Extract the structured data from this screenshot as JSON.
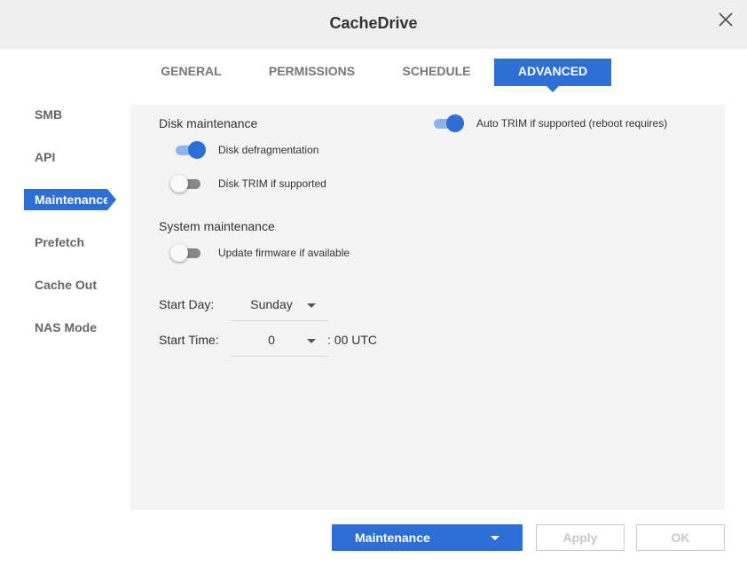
{
  "window": {
    "title": "CacheDrive"
  },
  "tabs": [
    {
      "label": "GENERAL"
    },
    {
      "label": "PERMISSIONS"
    },
    {
      "label": "SCHEDULE"
    },
    {
      "label": "ADVANCED",
      "active": true
    }
  ],
  "sidebar": {
    "items": [
      {
        "label": "SMB"
      },
      {
        "label": "API"
      },
      {
        "label": "Maintenance",
        "active": true
      },
      {
        "label": "Prefetch"
      },
      {
        "label": "Cache Out"
      },
      {
        "label": "NAS Mode"
      }
    ]
  },
  "disk_maintenance": {
    "heading": "Disk maintenance",
    "defrag": {
      "label": "Disk defragmentation",
      "on": true
    },
    "trim": {
      "label": "Disk TRIM if supported",
      "on": false
    },
    "auto_trim": {
      "label": "Auto TRIM if supported (reboot requires)",
      "on": true
    }
  },
  "system_maintenance": {
    "heading": "System maintenance",
    "firmware": {
      "label": "Update firmware if available",
      "on": false
    }
  },
  "schedule": {
    "start_day_label": "Start Day:",
    "start_day_value": "Sunday",
    "start_time_label": "Start Time:",
    "start_time_value": "0",
    "time_suffix": ": 00 UTC"
  },
  "footer": {
    "mode_button": "Maintenance",
    "apply_button": "Apply",
    "ok_button": "OK"
  },
  "colors": {
    "accent": "#2d6fd4",
    "toggle_on_track": "#8fb4ec",
    "panel_bg": "#f4f4f4",
    "titlebar_bg": "#efefef"
  },
  "icons": {
    "close": "close-icon",
    "dropdown": "chevron-down-icon"
  }
}
